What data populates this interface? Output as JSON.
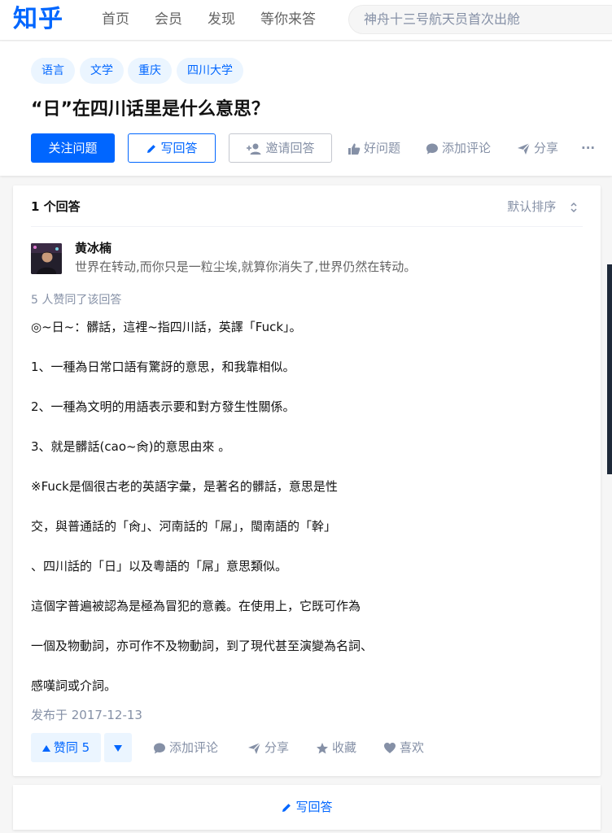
{
  "topbar": {
    "logo": "知乎",
    "nav": [
      "首页",
      "会员",
      "发现",
      "等你来答"
    ],
    "search_placeholder": "神舟十三号航天员首次出舱"
  },
  "question": {
    "tags": [
      "语言",
      "文学",
      "重庆",
      "四川大学"
    ],
    "title": "“日”在四川话里是什么意思？",
    "follow_label": "关注问题",
    "write_label": "写回答",
    "invite_label": "邀请回答",
    "good_label": "好问题",
    "comment_label": "添加评论",
    "share_label": "分享",
    "more_label": "···"
  },
  "answers": {
    "count_label": "1 个回答",
    "sort_label": "默认排序",
    "author": {
      "name": "黄冰楠",
      "bio": "世界在转动,而你只是一粒尘埃,就算你消失了,世界仍然在转动。"
    },
    "voters_label": "5 人赞同了该回答",
    "paragraphs": [
      "◎~日~：髒話，這裡~指四川話，英譯「Fuck」。",
      "1、一種為日常口語有驚訝的意思，和我靠相似。",
      "2、一種為文明的用語表示要和對方發生性關係。",
      "3、就是髒話(cao~肏)的意思由來 。",
      "※Fuck是個很古老的英語字彙，是著名的髒話，意思是性",
      "交，與普通話的「肏」、河南話的「屌」，閩南語的「幹」",
      "、四川話的「日」以及粵語的「屌」意思類似。",
      "這個字普遍被認為是極為冒犯的意義。在使用上，它既可作為",
      "一個及物動詞，亦可作不及物動詞，到了現代甚至演變為名詞、",
      "感嘆詞或介詞。"
    ],
    "published": "发布于 2017-12-13",
    "upvote_label": "赞同 5",
    "comment_label": "添加评论",
    "share_label": "分享",
    "collect_label": "收藏",
    "like_label": "喜欢"
  },
  "bottom": {
    "write_label": "写回答"
  },
  "colors": {
    "brand": "#0066ff",
    "muted": "#8590a6",
    "tag_bg": "#ebf5ff"
  }
}
